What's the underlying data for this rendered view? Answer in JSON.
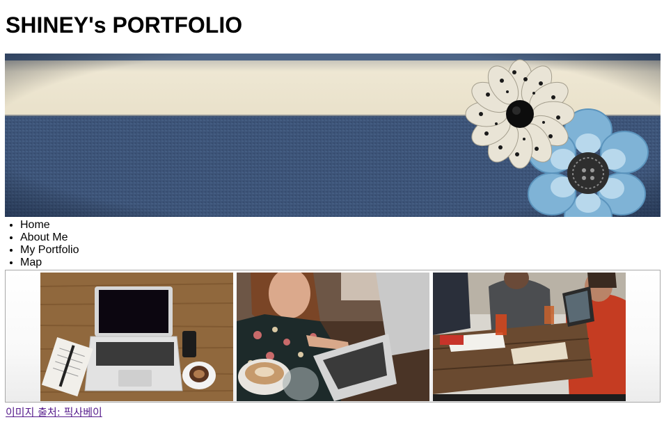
{
  "header": {
    "title": "SHINEY's PORTFOLIO"
  },
  "nav": {
    "items": [
      "Home",
      "About Me",
      "My Portfolio",
      "Map"
    ]
  },
  "gallery": {
    "images": [
      {
        "description": "laptop-on-wooden-desk"
      },
      {
        "description": "woman-typing-on-laptop-with-coffee"
      },
      {
        "description": "group-meeting-around-table"
      }
    ]
  },
  "footer": {
    "credit_link": "이미지 출처: 픽사베이"
  },
  "colors": {
    "denim": "#3d5478",
    "cream": "#ede6d2",
    "link_visited": "#551a8b"
  }
}
